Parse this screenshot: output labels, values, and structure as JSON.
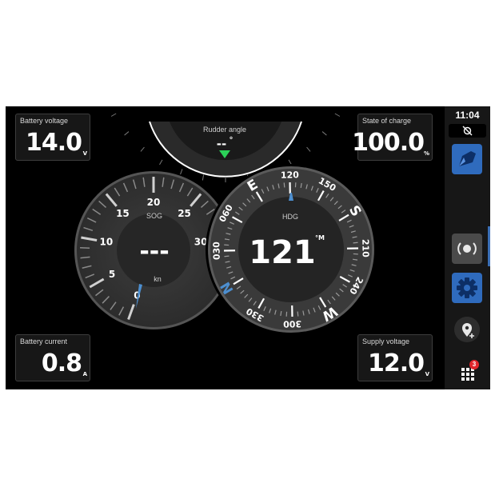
{
  "status": {
    "time": "11:04"
  },
  "tiles": {
    "battery_voltage": {
      "label": "Battery voltage",
      "value": "14.0",
      "unit": "V"
    },
    "state_of_charge": {
      "label": "State of charge",
      "value": "100.0",
      "unit": "%"
    },
    "battery_current": {
      "label": "Battery current",
      "value": "0.8",
      "unit": "A"
    },
    "supply_voltage": {
      "label": "Supply voltage",
      "value": "12.0",
      "unit": "V"
    }
  },
  "rudder": {
    "label": "Rudder angle",
    "value": "--",
    "unit": "°"
  },
  "sog": {
    "label": "SOG",
    "value": "---",
    "unit": "kn",
    "scale": [
      "0",
      "5",
      "10",
      "15",
      "20",
      "25",
      "30"
    ]
  },
  "hdg": {
    "label": "HDG",
    "value": "121",
    "unit": "°M",
    "heading_deg": 121,
    "numbers": [
      "030",
      "060",
      "120",
      "150",
      "210",
      "240",
      "300",
      "330"
    ],
    "cardinals": [
      "N",
      "E",
      "S",
      "W"
    ]
  },
  "sidebar": {
    "icons": [
      "sync-off-icon",
      "boat-app-icon",
      "sonar-icon",
      "settings-gear-icon",
      "add-waypoint-icon",
      "apps-grid-icon"
    ],
    "notification_count": "3"
  },
  "colors": {
    "accent_blue": "#2f6bbd",
    "rudder_marker": "#2bd158",
    "badge_red": "#e0252b",
    "needle_blue": "#4d8fd0"
  }
}
